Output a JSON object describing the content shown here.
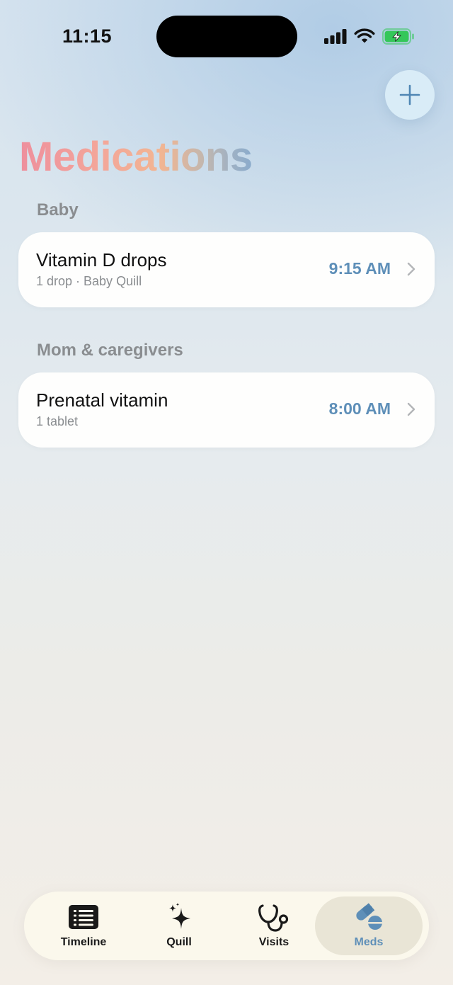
{
  "status_bar": {
    "time": "11:15"
  },
  "header": {
    "title": "Medications",
    "add_icon": "plus-icon"
  },
  "sections": [
    {
      "label": "Baby",
      "items": [
        {
          "name": "Vitamin D drops",
          "detail": "1 drop · Baby Quill",
          "time": "9:15 AM"
        }
      ]
    },
    {
      "label": "Mom & caregivers",
      "items": [
        {
          "name": "Prenatal vitamin",
          "detail": "1 tablet",
          "time": "8:00 AM"
        }
      ]
    }
  ],
  "tab_bar": {
    "tabs": [
      {
        "label": "Timeline",
        "icon": "list-icon"
      },
      {
        "label": "Quill",
        "icon": "sparkle-icon"
      },
      {
        "label": "Visits",
        "icon": "stethoscope-icon"
      },
      {
        "label": "Meds",
        "icon": "pills-icon",
        "active": true
      }
    ]
  },
  "colors": {
    "accent": "#5e8fb8",
    "battery": "#34c759",
    "card": "#fefefd",
    "secondary_text": "#8a8d90"
  }
}
